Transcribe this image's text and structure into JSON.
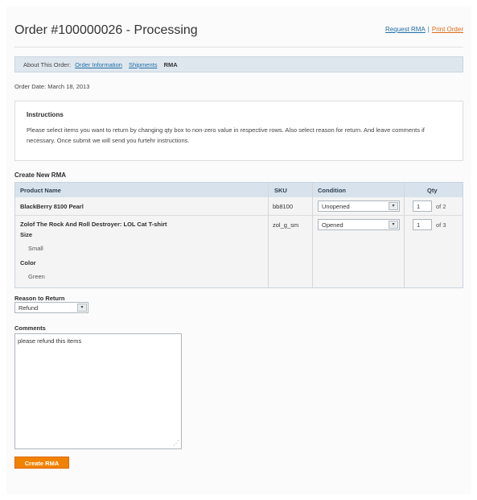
{
  "header": {
    "title": "Order #100000026 - Processing",
    "request_rma_link": "Request RMA",
    "separator": "|",
    "print_order_link": "Print Order"
  },
  "about": {
    "label": "About This Order:",
    "links": [
      "Order Information",
      "Shipments"
    ],
    "current": "RMA"
  },
  "order_date": "Order Date: March 18, 2013",
  "instructions": {
    "title": "Instructions",
    "text": "Please select items you want to return by changing qty box to non-zero value in respective rows. Also select reason for return. And leave comments if necessary. Once submit we will send you furtehr instructions."
  },
  "rma": {
    "heading": "Create New RMA",
    "columns": [
      "Product Name",
      "SKU",
      "Condition",
      "Qty"
    ],
    "rows": [
      {
        "name": "BlackBerry 8100 Pearl",
        "sku": "bb8100",
        "condition": "Unopened",
        "qty": "1",
        "of": "of 2"
      },
      {
        "name": "Zolof The Rock And Roll Destroyer: LOL Cat T-shirt",
        "size_label": "Size",
        "size_value": "Small",
        "color_label": "Color",
        "color_value": "Green",
        "sku": "zol_g_sm",
        "condition": "Opened",
        "qty": "1",
        "of": "of 3"
      }
    ]
  },
  "reason": {
    "label": "Reason to Return",
    "value": "Refund"
  },
  "comments": {
    "label": "Comments",
    "value": "please refund this items"
  },
  "submit_label": "Create RMA",
  "colors": {
    "accent": "#f18200",
    "link": "#1f6fa5",
    "header_bg": "#d7e2ec"
  }
}
